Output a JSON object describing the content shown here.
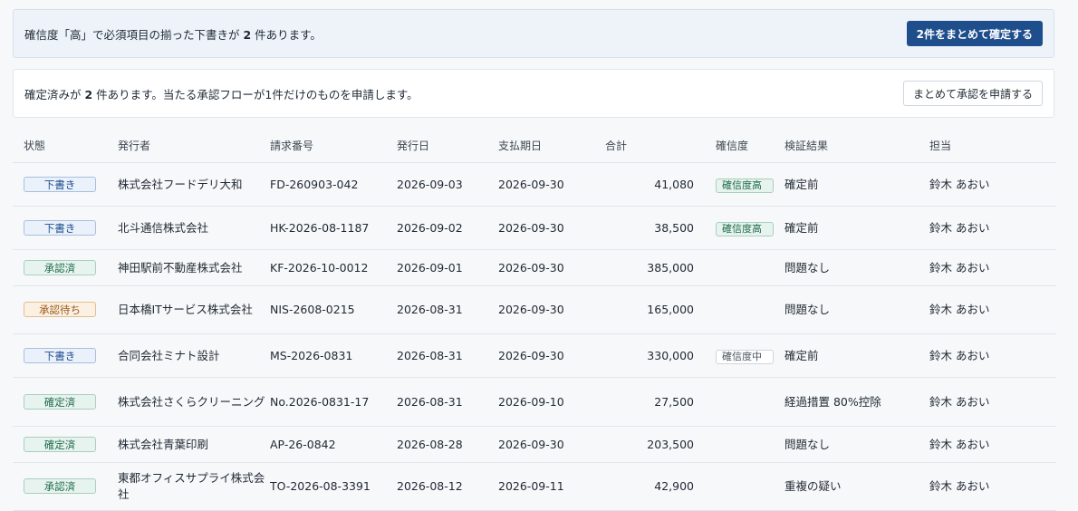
{
  "banner_confirm": {
    "text_prefix": "確信度「高」で必須項目の揃った下書きが ",
    "count": "2",
    "text_suffix": " 件あります。",
    "button_label": "2件をまとめて確定する"
  },
  "banner_approval": {
    "text_prefix": "確定済みが ",
    "count": "2",
    "text_suffix": " 件あります。当たる承認フローが1件だけのものを申請します。",
    "button_label": "まとめて承認を申請する"
  },
  "table": {
    "headers": {
      "status": "状態",
      "issuer": "発行者",
      "invoice_no": "請求番号",
      "issue_date": "発行日",
      "due_date": "支払期日",
      "total": "合計",
      "confidence": "確信度",
      "result": "検証結果",
      "owner": "担当"
    },
    "rows": [
      {
        "status": "下書き",
        "issuer": "株式会社フードデリ大和",
        "invoice_no": "FD-260903-042",
        "issue_date": "2026-09-03",
        "due_date": "2026-09-30",
        "total": "41,080",
        "confidence": "確信度高",
        "result": "確定前",
        "owner": "鈴木 あおい"
      },
      {
        "status": "下書き",
        "issuer": "北斗通信株式会社",
        "invoice_no": "HK-2026-08-1187",
        "issue_date": "2026-09-02",
        "due_date": "2026-09-30",
        "total": "38,500",
        "confidence": "確信度高",
        "result": "確定前",
        "owner": "鈴木 あおい"
      },
      {
        "status": "承認済",
        "issuer": "神田駅前不動産株式会社",
        "invoice_no": "KF-2026-10-0012",
        "issue_date": "2026-09-01",
        "due_date": "2026-09-30",
        "total": "385,000",
        "confidence": "",
        "result": "問題なし",
        "owner": "鈴木 あおい"
      },
      {
        "status": "承認待ち",
        "issuer": "日本橋ITサービス株式会社",
        "invoice_no": "NIS-2608-0215",
        "issue_date": "2026-08-31",
        "due_date": "2026-09-30",
        "total": "165,000",
        "confidence": "",
        "result": "問題なし",
        "owner": "鈴木 あおい"
      },
      {
        "status": "下書き",
        "issuer": "合同会社ミナト設計",
        "invoice_no": "MS-2026-0831",
        "issue_date": "2026-08-31",
        "due_date": "2026-09-30",
        "total": "330,000",
        "confidence": "確信度中",
        "result": "確定前",
        "owner": "鈴木 あおい"
      },
      {
        "status": "確定済",
        "issuer": "株式会社さくらクリーニング",
        "invoice_no": "No.2026-0831-17",
        "issue_date": "2026-08-31",
        "due_date": "2026-09-10",
        "total": "27,500",
        "confidence": "",
        "result": "経過措置 80%控除",
        "owner": "鈴木 あおい"
      },
      {
        "status": "確定済",
        "issuer": "株式会社青葉印刷",
        "invoice_no": "AP-26-0842",
        "issue_date": "2026-08-28",
        "due_date": "2026-09-30",
        "total": "203,500",
        "confidence": "",
        "result": "問題なし",
        "owner": "鈴木 あおい"
      },
      {
        "status": "承認済",
        "issuer": "東都オフィスサプライ株式会社",
        "invoice_no": "TO-2026-08-3391",
        "issue_date": "2026-08-12",
        "due_date": "2026-09-11",
        "total": "42,900",
        "confidence": "",
        "result": "重複の疑い",
        "owner": "鈴木 あおい"
      }
    ]
  },
  "colors": {
    "primary": "#1f4e8c",
    "ok": "#1f6b4d",
    "warn": "#b3651d",
    "pending": "#9a5a17"
  }
}
